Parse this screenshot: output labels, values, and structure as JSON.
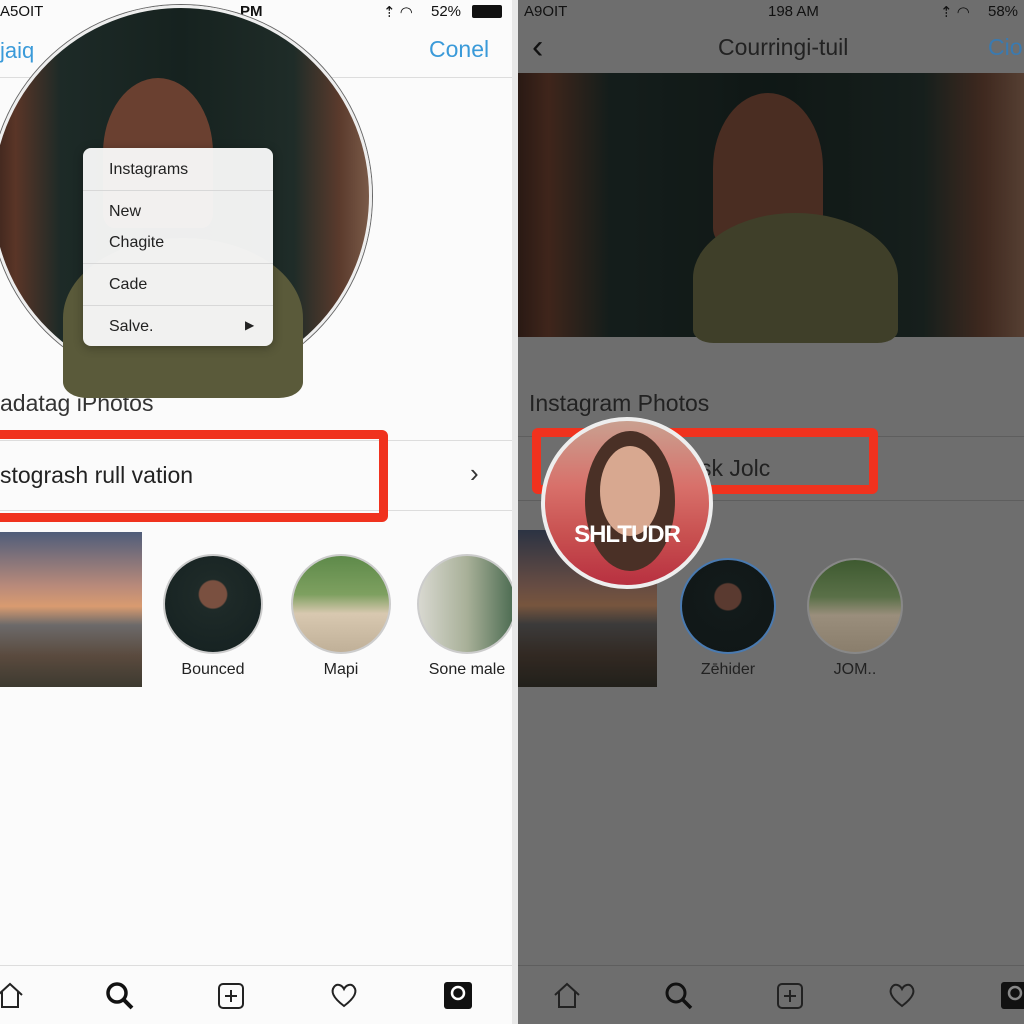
{
  "left": {
    "status": {
      "carrier": "A5OIT",
      "time": "PM",
      "battery": "52%"
    },
    "nav": {
      "left": "jaiq",
      "right": "Conel"
    },
    "menu": {
      "items": [
        {
          "label": "Instagrams"
        },
        {
          "label": "New"
        },
        {
          "label": "Chagite"
        },
        {
          "label": "Cade"
        },
        {
          "label": "Salve."
        }
      ]
    },
    "section_header": "adatag iPhotos",
    "row_label": "stogrash rull vation",
    "circles": [
      {
        "label": "Bounced"
      },
      {
        "label": "Mapi"
      },
      {
        "label": "Sone male"
      }
    ],
    "tabs": [
      "home-icon",
      "search-icon",
      "add-icon",
      "heart-icon",
      "profile-icon"
    ]
  },
  "right": {
    "status": {
      "carrier": "A9OIT",
      "time": "198 AM",
      "battery": "58%"
    },
    "nav": {
      "title": "Courringi-tuil",
      "right": "Cio"
    },
    "section_header": "Instagram Photos",
    "row_label": "sk Jolc",
    "magnified_caption": "SHLTUDR",
    "circles": [
      {
        "label": "Zēhider"
      },
      {
        "label": "JOM.."
      }
    ]
  },
  "colors": {
    "accent": "#3a9ad9",
    "highlight": "#f0321e"
  }
}
